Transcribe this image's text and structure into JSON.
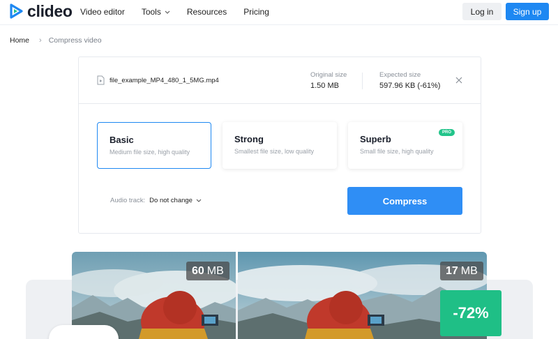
{
  "header": {
    "logo_text": "clideo",
    "nav": [
      {
        "label": "Video editor"
      },
      {
        "label": "Tools"
      },
      {
        "label": "Resources"
      },
      {
        "label": "Pricing"
      }
    ],
    "login_label": "Log in",
    "signup_label": "Sign up",
    "brand_color": "#1e88f2"
  },
  "breadcrumb": {
    "home": "Home",
    "current": "Compress video"
  },
  "file": {
    "name": "file_example_MP4_480_1_5MG.mp4",
    "original_label": "Original size",
    "original_value": "1.50 MB",
    "expected_label": "Expected size",
    "expected_value": "597.96 KB (-61%)"
  },
  "options": [
    {
      "title": "Basic",
      "desc": "Medium file size, high quality",
      "selected": true
    },
    {
      "title": "Strong",
      "desc": "Smallest file size, low quality",
      "selected": false
    },
    {
      "title": "Superb",
      "desc": "Small file size, high quality",
      "selected": false,
      "badge": "PRO"
    }
  ],
  "audio": {
    "label": "Audio track:",
    "value": "Do not change"
  },
  "compress_label": "Compress",
  "preview": {
    "left_size_num": "60",
    "left_size_unit": "MB",
    "right_size_num": "17",
    "right_size_unit": "MB",
    "reduction": "-72%"
  },
  "colors": {
    "accent": "#2f8ef5",
    "success": "#1fbf86"
  }
}
